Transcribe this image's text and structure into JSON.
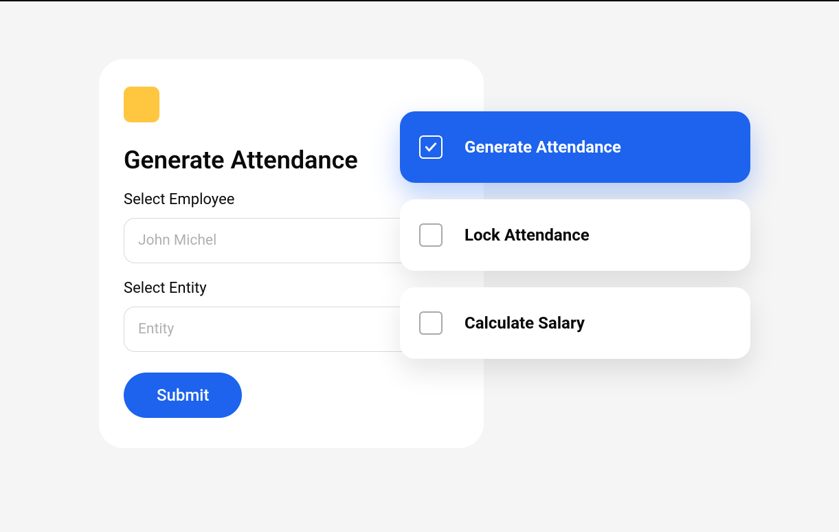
{
  "form": {
    "title": "Generate Attendance",
    "employee_label": "Select Employee",
    "employee_placeholder": "John Michel",
    "entity_label": "Select Entity",
    "entity_placeholder": "Entity",
    "submit_label": "Submit"
  },
  "options": {
    "generate_attendance": "Generate Attendance",
    "lock_attendance": "Lock Attendance",
    "calculate_salary": "Calculate Salary"
  },
  "colors": {
    "primary": "#1D63ED",
    "badge": "#FFC640"
  }
}
